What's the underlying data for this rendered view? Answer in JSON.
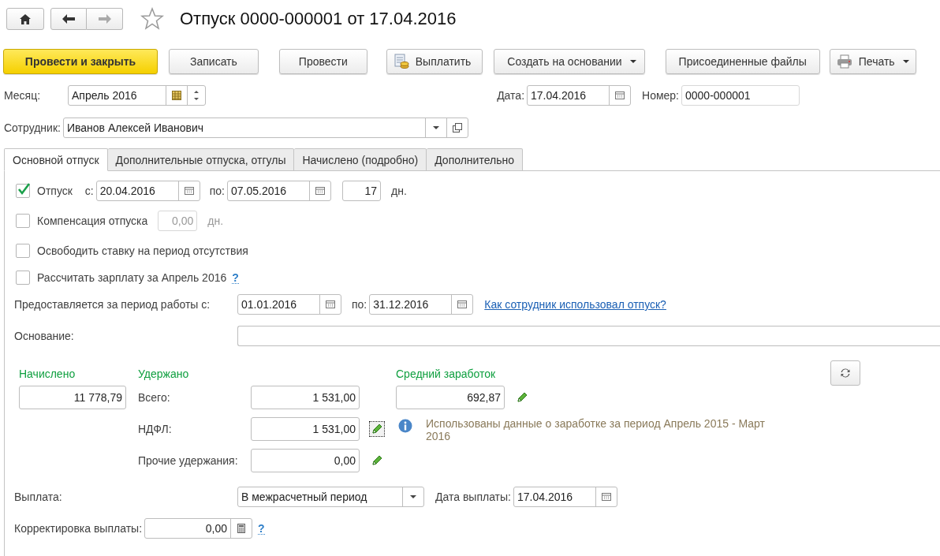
{
  "title": "Отпуск 0000-000001 от 17.04.2016",
  "favorite": false,
  "toolbar": [
    {
      "label": "Провести и закрыть",
      "kind": "primary"
    },
    {
      "label": "Записать",
      "kind": "plain"
    },
    {
      "label": "Провести",
      "kind": "plain"
    },
    {
      "label": "Выплатить",
      "kind": "pay"
    },
    {
      "label": "Создать на основании",
      "kind": "menu"
    },
    {
      "label": "Присоединенные файлы",
      "kind": "plain"
    },
    {
      "label": "Печать",
      "kind": "print"
    }
  ],
  "month": {
    "label": "Месяц:",
    "value": "Апрель 2016"
  },
  "date": {
    "label": "Дата:",
    "value": "17.04.2016"
  },
  "number": {
    "label": "Номер:",
    "value": "0000-000001"
  },
  "employee": {
    "label": "Сотрудник:",
    "value": "Иванов Алексей Иванович"
  },
  "tabs": [
    {
      "label": "Основной отпуск",
      "selected": true
    },
    {
      "label": "Дополнительные отпуска, отгулы",
      "selected": false
    },
    {
      "label": "Начислено (подробно)",
      "selected": false
    },
    {
      "label": "Дополнительно",
      "selected": false
    }
  ],
  "vacation": {
    "checked": true,
    "label": "Отпуск",
    "from_label": "с:",
    "from": "20.04.2016",
    "to_label": "по:",
    "to": "07.05.2016",
    "days": "17",
    "unit": "дн."
  },
  "compensation": {
    "checked": false,
    "label": "Компенсация отпуска",
    "value": "0,00",
    "disabled": true,
    "unit": "дн."
  },
  "release_rate": {
    "checked": false,
    "label": "Освободить ставку на период отсутствия"
  },
  "calc_salary": {
    "checked": false,
    "label": "Рассчитать зарплату за Апрель 2016",
    "help": "?"
  },
  "period": {
    "label": "Предоставляется за период работы с:",
    "from": "01.01.2016",
    "to_label": "по:",
    "to": "31.12.2016",
    "link": "Как сотрудник использовал отпуск?"
  },
  "basis": {
    "label": "Основание:"
  },
  "accrued": {
    "heading": "Начислено",
    "value": "11 778,79"
  },
  "withheld": {
    "heading": "Удержано",
    "rows": [
      {
        "label": "Всего:",
        "value": "1 531,00",
        "editable": false
      },
      {
        "label": "НДФЛ:",
        "value": "1 531,00",
        "editable": true,
        "focused": true
      },
      {
        "label": "Прочие удержания:",
        "value": "0,00",
        "editable": true,
        "focused": false
      }
    ]
  },
  "average": {
    "heading": "Средний заработок",
    "value": "692,87",
    "note": "Использованы данные о заработке за период Апрель 2015 - Март 2016"
  },
  "payment": {
    "label": "Выплата:",
    "value": "В межрасчетный период",
    "date_label": "Дата выплаты:",
    "date": "17.04.2016"
  },
  "correction": {
    "label": "Корректировка выплаты:",
    "value": "0,00",
    "help": "?"
  }
}
